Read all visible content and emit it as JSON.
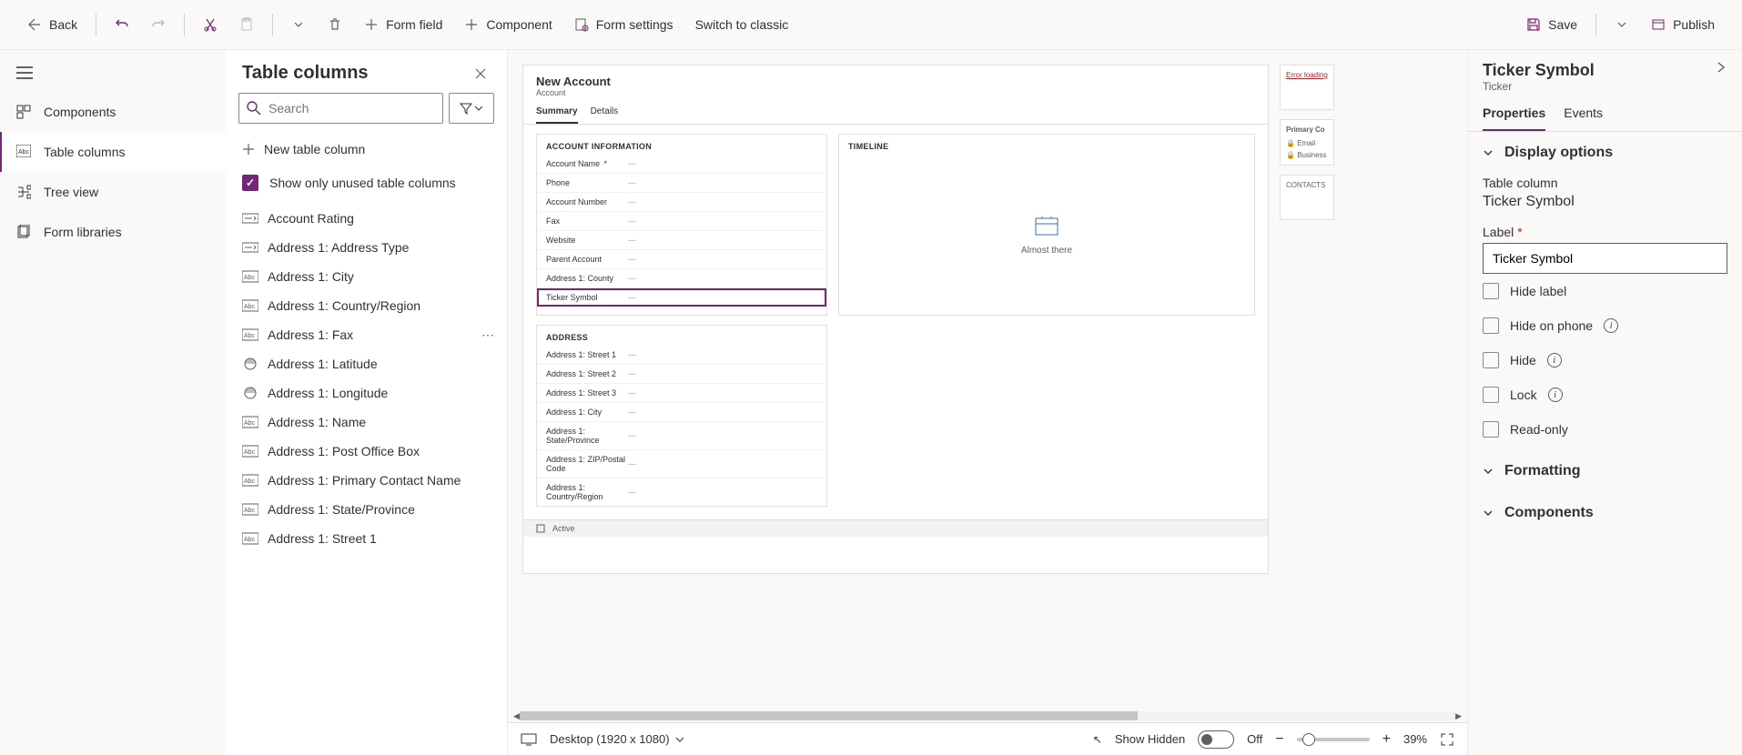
{
  "toolbar": {
    "back": "Back",
    "form_field": "Form field",
    "component": "Component",
    "form_settings": "Form settings",
    "switch_classic": "Switch to classic",
    "save": "Save",
    "publish": "Publish"
  },
  "nav": {
    "components": "Components",
    "table_columns": "Table columns",
    "tree_view": "Tree view",
    "form_libraries": "Form libraries"
  },
  "colsPanel": {
    "title": "Table columns",
    "search_placeholder": "Search",
    "new_col": "New table column",
    "unused_label": "Show only unused table columns",
    "items": [
      {
        "label": "Account Rating",
        "type": "option"
      },
      {
        "label": "Address 1: Address Type",
        "type": "option"
      },
      {
        "label": "Address 1: City",
        "type": "text"
      },
      {
        "label": "Address 1: Country/Region",
        "type": "text"
      },
      {
        "label": "Address 1: Fax",
        "type": "text",
        "hover": true
      },
      {
        "label": "Address 1: Latitude",
        "type": "float"
      },
      {
        "label": "Address 1: Longitude",
        "type": "float"
      },
      {
        "label": "Address 1: Name",
        "type": "text"
      },
      {
        "label": "Address 1: Post Office Box",
        "type": "text"
      },
      {
        "label": "Address 1: Primary Contact Name",
        "type": "text"
      },
      {
        "label": "Address 1: State/Province",
        "type": "text"
      },
      {
        "label": "Address 1: Street 1",
        "type": "text"
      }
    ]
  },
  "form": {
    "title": "New Account",
    "subtitle": "Account",
    "tabs": [
      "Summary",
      "Details"
    ],
    "section1_title": "ACCOUNT INFORMATION",
    "fields1": [
      {
        "label": "Account Name",
        "required": true
      },
      {
        "label": "Phone"
      },
      {
        "label": "Account Number"
      },
      {
        "label": "Fax"
      },
      {
        "label": "Website"
      },
      {
        "label": "Parent Account"
      },
      {
        "label": "Address 1: County"
      },
      {
        "label": "Ticker Symbol",
        "selected": true
      }
    ],
    "section2_title": "ADDRESS",
    "fields2": [
      {
        "label": "Address 1: Street 1"
      },
      {
        "label": "Address 1: Street 2"
      },
      {
        "label": "Address 1: Street 3"
      },
      {
        "label": "Address 1: City"
      },
      {
        "label": "Address 1: State/Province"
      },
      {
        "label": "Address 1: ZIP/Postal Code"
      },
      {
        "label": "Address 1: Country/Region"
      }
    ],
    "timeline_title": "Timeline",
    "timeline_msg": "Almost there",
    "status": "Active",
    "err_loading": "Error loading",
    "side_primary": "Primary Co",
    "side_email": "Email",
    "side_business": "Business",
    "side_contacts": "CONTACTS"
  },
  "bottom": {
    "viewport": "Desktop (1920 x 1080)",
    "show_hidden": "Show Hidden",
    "toggle_state": "Off",
    "zoom": "39%"
  },
  "props": {
    "title": "Ticker Symbol",
    "subtitle": "Ticker",
    "tabs": [
      "Properties",
      "Events"
    ],
    "sec_display": "Display options",
    "table_column_label": "Table column",
    "table_column_value": "Ticker Symbol",
    "label_label": "Label",
    "label_value": "Ticker Symbol",
    "hide_label": "Hide label",
    "hide_phone": "Hide on phone",
    "hide": "Hide",
    "lock": "Lock",
    "readonly": "Read-only",
    "sec_formatting": "Formatting",
    "sec_components": "Components"
  }
}
